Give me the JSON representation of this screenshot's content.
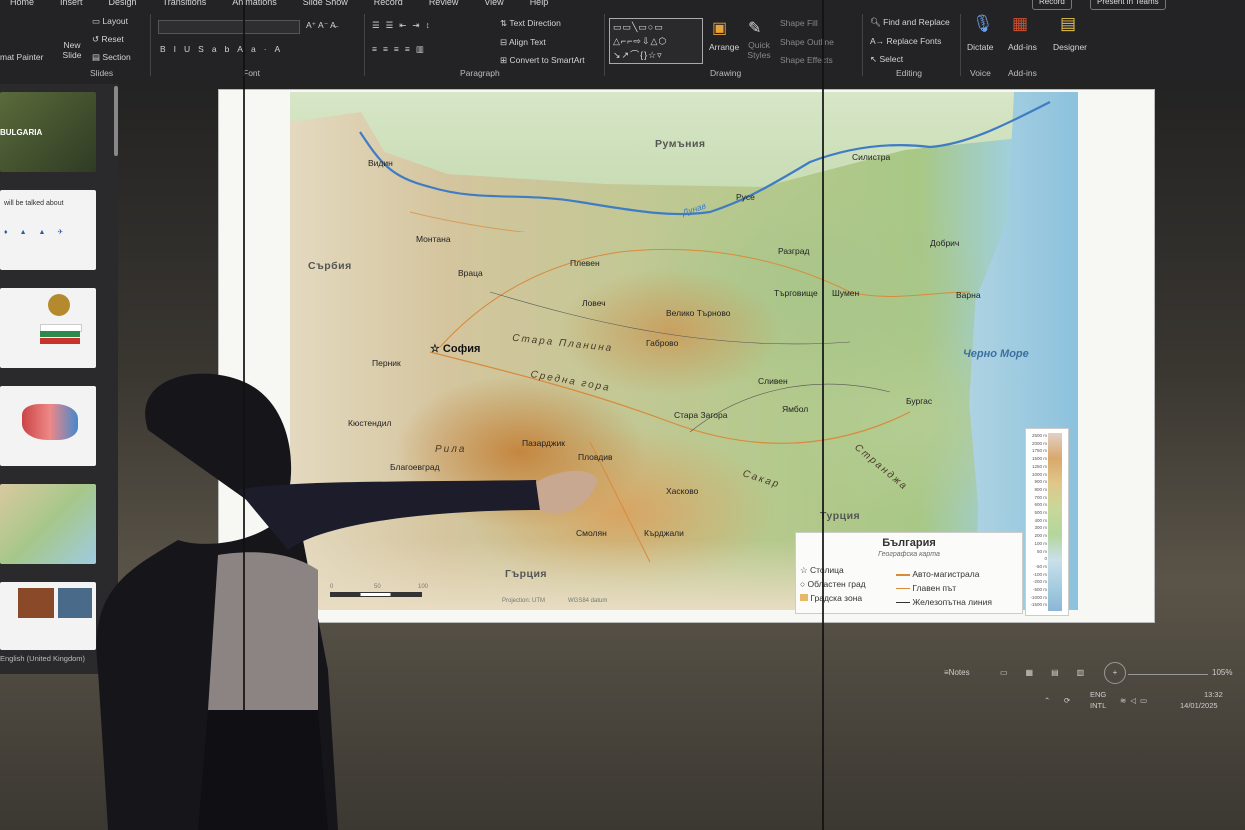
{
  "menu": [
    "Home",
    "Insert",
    "Design",
    "Transitions",
    "Animations",
    "Slide Show",
    "Record",
    "Review",
    "View",
    "Help"
  ],
  "ribbon": {
    "format_painter": "mat Painter",
    "new_slide": "New Slide",
    "layout": "Layout",
    "reset": "Reset",
    "section": "Section",
    "text_direction": "Text Direction",
    "align_text": "Align Text",
    "convert_smartart": "Convert to SmartArt",
    "arrange": "Arrange",
    "quick_styles": "Quick Styles",
    "shape_fill": "Shape Fill",
    "shape_outline": "Shape Outline",
    "shape_effects": "Shape Effects",
    "find_replace": "Find and Replace",
    "replace_fonts": "Replace Fonts",
    "select": "Select",
    "dictate": "Dictate",
    "addins": "Add-ins",
    "designer": "Designer",
    "record": "Record",
    "present_teams": "Present in Teams",
    "groups": {
      "slides": "Slides",
      "font": "Font",
      "paragraph": "Paragraph",
      "drawing": "Drawing",
      "editing": "Editing",
      "voice": "Voice",
      "addins": "Add-ins"
    }
  },
  "thumbnails": {
    "t1": "BULGARIA",
    "t2": "will be talked about"
  },
  "map": {
    "countries": {
      "romania": "Румъния",
      "serbia": "Сърбия",
      "greece": "Гърция",
      "turkey": "Турция"
    },
    "river": "Дунав",
    "sea": "Черно Море",
    "capital": "София",
    "mountains": {
      "stara": "Стара Планина",
      "sredna": "Средна гора",
      "rila": "Рила",
      "sakar": "Сакар",
      "strandzha": "Странджа"
    },
    "cities": {
      "vidin": "Видин",
      "montana": "Монтана",
      "vratsa": "Враца",
      "pleven": "Плевен",
      "ruse": "Русе",
      "silistra": "Силистра",
      "razgrad": "Разград",
      "dobrich": "Добрич",
      "targovishte": "Търговище",
      "shumen": "Шумен",
      "varna": "Варна",
      "lovech": "Ловеч",
      "veliko": "Велико Търново",
      "gabrovo": "Габрово",
      "pernik": "Перник",
      "kyustendil": "Кюстендил",
      "blagoevgrad": "Благоевград",
      "pazardzhik": "Пазарджик",
      "plovdiv": "Пловдив",
      "stara_zagora": "Стара Загора",
      "sliven": "Сливен",
      "yambol": "Ямбол",
      "burgas": "Бургас",
      "haskovo": "Хасково",
      "kardzhali": "Кърджали",
      "smolyan": "Смолян"
    },
    "scale": [
      "0",
      "50",
      "100"
    ],
    "projection": "Projection: UTM",
    "datum": "WGS84 datum"
  },
  "legend": {
    "title": "България",
    "subtitle": "Географска карта",
    "capital": "Столица",
    "regional_city": "Областен град",
    "urban_zone": "Градска зона",
    "motorway": "Авто-магистрала",
    "main_road": "Главен път",
    "railway": "Железопътна линия"
  },
  "elevation_ticks": [
    "2500 m",
    "2000 m",
    "1750 m",
    "1500 m",
    "1250 m",
    "1000 m",
    "900 m",
    "800 m",
    "700 m",
    "600 m",
    "500 m",
    "400 m",
    "300 m",
    "200 m",
    "100 m",
    "50 m",
    "0",
    "-50 m",
    "-100 m",
    "-200 m",
    "-500 m",
    "-1000 m",
    "-1500 m"
  ],
  "status": {
    "notes": "Notes",
    "zoom": "105%",
    "language": "English (United Kingdom)"
  },
  "taskbar": {
    "lang1": "ENG",
    "lang2": "INTL",
    "time": "13:32",
    "date": "14/01/2025"
  },
  "colors": {
    "danube": "#3f7cc4",
    "road": "#d98a3a",
    "ribbon_bg": "#232326"
  }
}
